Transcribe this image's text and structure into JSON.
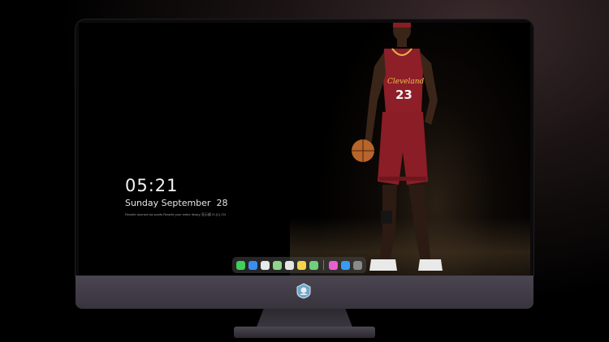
{
  "lockscreen": {
    "time": "05:21",
    "date": "Sunday September  28",
    "tagline": "Rewrite dunned via scarfs Rewrite your entire library 显示器 Xi (C) CN"
  },
  "dock": {
    "apps": [
      {
        "icon": "messages-icon",
        "color": "#3fcf5a"
      },
      {
        "icon": "finder-icon",
        "color": "#3b8df0"
      },
      {
        "icon": "safari-icon",
        "color": "#e8e8e8"
      },
      {
        "icon": "maps-icon",
        "color": "#8fd48a"
      },
      {
        "icon": "clapper-icon",
        "color": "#e6e6e6"
      },
      {
        "icon": "notes-icon",
        "color": "#f3d54a"
      },
      {
        "icon": "photos-icon",
        "color": "#6fcf7a"
      },
      {
        "icon": "itunes-icon",
        "color": "#e85fd0"
      },
      {
        "icon": "app-store-icon",
        "color": "#3a9bf4"
      },
      {
        "icon": "camera-icon",
        "color": "#8a8a8a"
      }
    ]
  },
  "wallpaper": {
    "subject": "basketball-player",
    "jersey_number": "23",
    "jersey_text": "Cleveland"
  }
}
